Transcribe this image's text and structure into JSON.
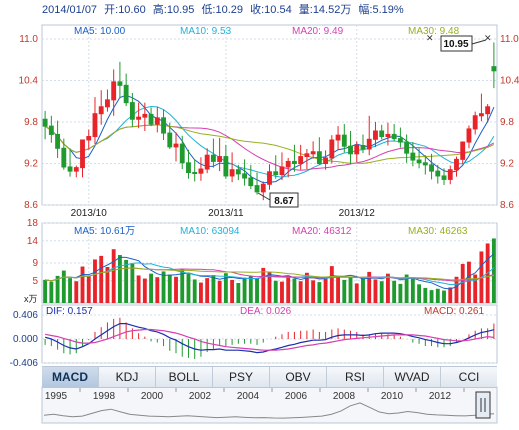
{
  "header": {
    "date": "2014/01/07",
    "open_label": "开:",
    "open": "10.60",
    "high_label": "高:",
    "high": "10.95",
    "low_label": "低:",
    "low": "10.29",
    "close_label": "收:",
    "close": "10.54",
    "volume_label": "量:",
    "volume": "14.52万",
    "change_label": "幅:",
    "change": "5.19%"
  },
  "price_panel": {
    "ma_labels": [
      "MA5: 10.00",
      "MA10: 9.53",
      "MA20: 9.49",
      "MA30: 9.48"
    ],
    "yticks": [
      "11.0",
      "10.4",
      "9.8",
      "9.2",
      "8.6"
    ],
    "xticks": [
      "2013/10",
      "2013/11",
      "2013/12"
    ],
    "high_marker": "10.95",
    "low_marker": "8.67"
  },
  "volume_panel": {
    "ma_labels": [
      "MA5: 10.61万",
      "MA10: 63094",
      "MA20: 46312",
      "MA30: 46263"
    ],
    "yticks": [
      "18",
      "14",
      "9",
      "5",
      "x万"
    ]
  },
  "macd_panel": {
    "dif_label": "DIF: 0.157",
    "dea_label": "DEA: 0.026",
    "macd_label": "MACD: 0.261",
    "yticks": [
      "0.406",
      "0.000",
      "-0.406"
    ]
  },
  "tabs": [
    "MACD",
    "KDJ",
    "BOLL",
    "PSY",
    "OBV",
    "RSI",
    "WVAD",
    "CCI"
  ],
  "active_tab": "MACD",
  "years": [
    "1995",
    "1998",
    "2000",
    "2002",
    "2004",
    "2006",
    "2008",
    "2010",
    "2012"
  ],
  "colors": {
    "up": "#e8242a",
    "down": "#1f9a2f",
    "ma5": "#1a5fc8",
    "ma10": "#1fb3d8",
    "ma20": "#d63fb0",
    "ma30": "#97b020",
    "dif": "#1a2fb0",
    "dea": "#d63fb0",
    "grid": "#d4dde8",
    "label": "#1b3f8f"
  },
  "chart_data": {
    "type": "candlestick",
    "price": {
      "open": [
        9.84,
        9.74,
        9.62,
        9.42,
        9.15,
        9.09,
        9.14,
        9.54,
        9.59,
        9.92,
        10.02,
        10.12,
        10.38,
        10.33,
        10.08,
        9.84,
        9.87,
        9.91,
        9.77,
        9.86,
        9.64,
        9.44,
        9.48,
        9.21,
        9.07,
        9.06,
        9.12,
        9.32,
        9.23,
        9.3,
        9.02,
        9.11,
        9.05,
        8.99,
        8.88,
        8.79,
        8.9,
        9.08,
        9.04,
        9.15,
        9.23,
        9.2,
        9.3,
        9.34,
        9.37,
        9.2,
        9.28,
        9.54,
        9.61,
        9.45,
        9.34,
        9.46,
        9.41,
        9.55,
        9.67,
        9.59,
        9.62,
        9.56,
        9.51,
        9.35,
        9.25,
        9.21,
        9.18,
        9.09,
        9.02,
        8.97,
        9.11,
        9.26,
        9.51,
        9.7,
        9.89,
        9.92,
        10.6
      ],
      "high": [
        9.96,
        9.89,
        9.82,
        9.56,
        9.42,
        9.17,
        9.41,
        9.69,
        10.16,
        10.26,
        10.27,
        10.56,
        10.67,
        10.5,
        10.22,
        10.08,
        10.08,
        10.01,
        10.02,
        9.98,
        9.79,
        9.65,
        9.6,
        9.4,
        9.26,
        9.29,
        9.42,
        9.56,
        9.57,
        9.47,
        9.36,
        9.18,
        9.26,
        9.18,
        9.07,
        8.94,
        9.19,
        9.32,
        9.36,
        9.28,
        9.47,
        9.47,
        9.41,
        9.52,
        9.58,
        9.39,
        9.61,
        9.74,
        9.77,
        9.67,
        9.52,
        9.62,
        9.89,
        9.8,
        9.76,
        9.79,
        9.77,
        9.72,
        9.62,
        9.51,
        9.42,
        9.32,
        9.34,
        9.18,
        9.13,
        9.17,
        9.3,
        9.52,
        9.75,
        9.95,
        10.21,
        10.06,
        10.95
      ],
      "low": [
        9.55,
        9.5,
        9.28,
        9.11,
        9.01,
        9.0,
        9.0,
        9.4,
        9.48,
        9.76,
        9.95,
        9.89,
        10.14,
        10.03,
        9.73,
        9.71,
        9.67,
        9.74,
        9.65,
        9.54,
        9.41,
        9.23,
        9.12,
        8.98,
        8.94,
        8.95,
        9.06,
        9.14,
        9.09,
        8.98,
        8.93,
        8.96,
        8.88,
        8.83,
        8.75,
        8.67,
        8.82,
        8.98,
        8.96,
        9.0,
        9.08,
        9.11,
        9.12,
        9.27,
        9.18,
        9.11,
        9.2,
        9.4,
        9.36,
        9.19,
        9.22,
        9.35,
        9.32,
        9.44,
        9.55,
        9.46,
        9.52,
        9.43,
        9.21,
        9.16,
        9.13,
        9.04,
        8.97,
        8.91,
        8.89,
        8.9,
        9.01,
        9.19,
        9.42,
        9.62,
        9.81,
        9.79,
        10.29
      ],
      "close": [
        9.74,
        9.62,
        9.42,
        9.15,
        9.09,
        9.14,
        9.54,
        9.59,
        9.92,
        10.02,
        10.12,
        10.38,
        10.33,
        10.08,
        9.84,
        9.87,
        9.91,
        9.77,
        9.86,
        9.64,
        9.44,
        9.48,
        9.21,
        9.07,
        9.06,
        9.12,
        9.32,
        9.23,
        9.3,
        9.02,
        9.11,
        9.05,
        8.99,
        8.88,
        8.79,
        8.9,
        9.08,
        9.04,
        9.15,
        9.23,
        9.2,
        9.3,
        9.34,
        9.37,
        9.2,
        9.28,
        9.54,
        9.61,
        9.45,
        9.34,
        9.46,
        9.41,
        9.55,
        9.67,
        9.59,
        9.62,
        9.56,
        9.51,
        9.35,
        9.25,
        9.21,
        9.18,
        9.09,
        9.02,
        8.97,
        9.11,
        9.26,
        9.51,
        9.7,
        9.89,
        9.92,
        10.02,
        10.54
      ]
    },
    "volume_wan": [
      5.2,
      4.8,
      6.1,
      7.3,
      5.6,
      4.9,
      8.2,
      6.0,
      9.8,
      10.6,
      8.1,
      12.1,
      10.8,
      9.7,
      8.8,
      6.2,
      5.5,
      6.6,
      5.8,
      7.1,
      6.4,
      5.9,
      7.6,
      6.8,
      5.3,
      4.6,
      5.6,
      6.3,
      5.0,
      6.7,
      5.2,
      4.5,
      5.7,
      6.1,
      5.4,
      7.9,
      6.9,
      5.0,
      4.8,
      6.2,
      5.5,
      4.9,
      6.8,
      5.1,
      4.7,
      5.9,
      8.3,
      6.0,
      5.2,
      5.8,
      4.4,
      5.6,
      7.0,
      5.3,
      4.9,
      6.6,
      5.0,
      4.3,
      6.4,
      5.8,
      4.2,
      3.4,
      2.9,
      3.2,
      2.8,
      3.5,
      5.9,
      8.8,
      9.3,
      6.4,
      11.6,
      13.4,
      14.52
    ],
    "macd": {
      "dif": [
        0.03,
        0.0,
        -0.05,
        -0.11,
        -0.15,
        -0.17,
        -0.13,
        -0.08,
        0.0,
        0.07,
        0.14,
        0.21,
        0.26,
        0.26,
        0.23,
        0.2,
        0.18,
        0.14,
        0.12,
        0.08,
        0.02,
        -0.02,
        -0.08,
        -0.13,
        -0.17,
        -0.19,
        -0.18,
        -0.18,
        -0.17,
        -0.19,
        -0.19,
        -0.19,
        -0.2,
        -0.21,
        -0.23,
        -0.22,
        -0.19,
        -0.17,
        -0.14,
        -0.11,
        -0.09,
        -0.06,
        -0.04,
        -0.02,
        -0.02,
        -0.01,
        0.03,
        0.06,
        0.07,
        0.07,
        0.07,
        0.06,
        0.07,
        0.09,
        0.1,
        0.1,
        0.1,
        0.09,
        0.07,
        0.04,
        0.02,
        -0.01,
        -0.03,
        -0.06,
        -0.08,
        -0.08,
        -0.06,
        -0.03,
        0.02,
        0.07,
        0.11,
        0.13,
        0.157
      ],
      "dea": [
        0.08,
        0.06,
        0.04,
        0.01,
        -0.02,
        -0.05,
        -0.07,
        -0.07,
        -0.06,
        -0.03,
        0.0,
        0.04,
        0.08,
        0.12,
        0.14,
        0.15,
        0.16,
        0.16,
        0.15,
        0.14,
        0.12,
        0.1,
        0.07,
        0.03,
        0.0,
        -0.04,
        -0.07,
        -0.09,
        -0.11,
        -0.13,
        -0.14,
        -0.15,
        -0.16,
        -0.17,
        -0.18,
        -0.19,
        -0.19,
        -0.19,
        -0.18,
        -0.17,
        -0.15,
        -0.13,
        -0.11,
        -0.1,
        -0.08,
        -0.07,
        -0.05,
        -0.03,
        -0.01,
        0.0,
        0.01,
        0.02,
        0.03,
        0.04,
        0.05,
        0.06,
        0.07,
        0.07,
        0.07,
        0.07,
        0.06,
        0.05,
        0.03,
        0.01,
        -0.01,
        -0.02,
        -0.03,
        -0.03,
        -0.02,
        0.0,
        0.02,
        0.04,
        0.026
      ],
      "macd": [
        -0.1,
        -0.12,
        -0.18,
        -0.24,
        -0.26,
        -0.24,
        -0.12,
        -0.02,
        0.12,
        0.2,
        0.28,
        0.34,
        0.36,
        0.28,
        0.18,
        0.1,
        0.04,
        -0.04,
        -0.06,
        -0.12,
        -0.2,
        -0.24,
        -0.3,
        -0.32,
        -0.34,
        -0.3,
        -0.22,
        -0.18,
        -0.12,
        -0.12,
        -0.1,
        -0.08,
        -0.08,
        -0.08,
        -0.1,
        -0.06,
        0.0,
        0.04,
        0.08,
        0.12,
        0.12,
        0.14,
        0.14,
        0.16,
        0.12,
        0.12,
        0.16,
        0.18,
        0.16,
        0.14,
        0.12,
        0.08,
        0.08,
        0.1,
        0.1,
        0.08,
        0.06,
        0.04,
        0.0,
        -0.06,
        -0.08,
        -0.12,
        -0.12,
        -0.14,
        -0.14,
        -0.12,
        -0.06,
        0.0,
        0.08,
        0.14,
        0.18,
        0.18,
        0.261
      ]
    },
    "ranges": {
      "price": [
        8.6,
        11.0
      ],
      "volume": [
        0,
        18
      ],
      "macd": [
        -0.406,
        0.406
      ]
    },
    "xticks": [
      "2013/10",
      "2013/11",
      "2013/12"
    ],
    "overview": [
      0.3,
      0.36,
      0.28,
      0.22,
      0.26,
      0.4,
      0.55,
      0.62,
      0.48,
      0.35,
      0.3,
      0.26,
      0.24,
      0.22,
      0.25,
      0.28,
      0.24,
      0.21,
      0.18,
      0.2,
      0.22,
      0.19,
      0.17,
      0.18,
      0.16,
      0.15,
      0.17,
      0.19,
      0.22,
      0.26,
      0.35,
      0.52,
      0.8,
      0.95,
      0.72,
      0.48,
      0.38,
      0.42,
      0.5,
      0.44,
      0.36,
      0.32,
      0.3,
      0.28,
      0.27,
      0.3,
      0.35,
      0.38
    ]
  }
}
